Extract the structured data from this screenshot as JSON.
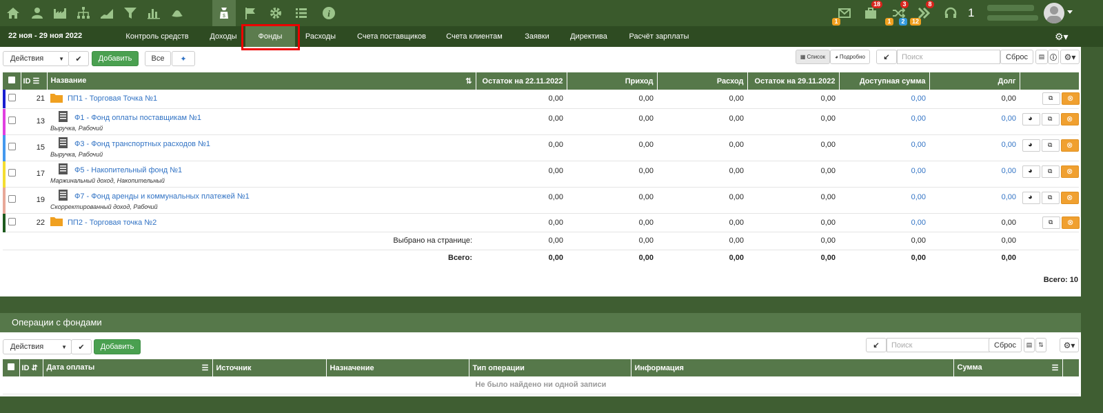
{
  "nav": {
    "icons": [
      "home-icon",
      "user-icon",
      "factory-icon",
      "org-chart-icon",
      "chart-area-icon",
      "filter-icon",
      "bar-chart-icon",
      "hat-icon",
      "money-bag-icon",
      "flag-icon",
      "gear-icon",
      "list-icon",
      "info-icon"
    ],
    "active": "money-bag-icon"
  },
  "header": {
    "messages_badge": "1",
    "tasks_badge": "18",
    "tasks_sub": "1",
    "shuffle_badge": "3",
    "shuffle_sub_a": "2",
    "shuffle_sub_b": "12",
    "forward_badge": "8",
    "counter": "1"
  },
  "subnav": {
    "date_range": "22 ноя - 29 ноя 2022",
    "tabs": [
      "Контроль средств",
      "Доходы",
      "Фонды",
      "Расходы",
      "Счета поставщиков",
      "Счета клиентам",
      "Заявки",
      "Директива",
      "Расчёт зарплаты"
    ],
    "active_tab": "Фонды"
  },
  "toolbar": {
    "actions": "Действия",
    "add": "Добавить",
    "all": "Все",
    "view_list": "Список",
    "view_detail": "Подробно",
    "search_placeholder": "Поиск",
    "reset": "Сброс"
  },
  "funds_table": {
    "headers": {
      "id": "ID",
      "name": "Название",
      "opening": "Остаток на 22.11.2022",
      "income": "Приход",
      "expense": "Расход",
      "closing": "Остаток на 29.11.2022",
      "available": "Доступная сумма",
      "debt": "Долг"
    },
    "rows": [
      {
        "id": "21",
        "name": "ПП1 - Торговая Точка №1",
        "tags": "",
        "kind": "folder",
        "color": "#1a1fd0",
        "opening": "0,00",
        "income": "0,00",
        "expense": "0,00",
        "closing": "0,00",
        "available": "0,00",
        "debt": "0,00"
      },
      {
        "id": "13",
        "name": "Ф1 - Фонд оплаты поставщикам №1",
        "tags": "Выручка, Рабочий",
        "kind": "doc",
        "color": "#e040e0",
        "opening": "0,00",
        "income": "0,00",
        "expense": "0,00",
        "closing": "0,00",
        "available": "0,00",
        "debt": "0,00"
      },
      {
        "id": "15",
        "name": "Ф3 - Фонд транспортных расходов №1",
        "tags": "Выручка, Рабочий",
        "kind": "doc",
        "color": "#4499ee",
        "opening": "0,00",
        "income": "0,00",
        "expense": "0,00",
        "closing": "0,00",
        "available": "0,00",
        "debt": "0,00"
      },
      {
        "id": "17",
        "name": "Ф5 - Накопительный фонд №1",
        "tags": "Маржинальный доход, Накопительный",
        "kind": "doc",
        "color": "#f4dd30",
        "opening": "0,00",
        "income": "0,00",
        "expense": "0,00",
        "closing": "0,00",
        "available": "0,00",
        "debt": "0,00"
      },
      {
        "id": "19",
        "name": "Ф7 - Фонд аренды и коммунальных платежей №1",
        "tags": "Скорректированный доход, Рабочий",
        "kind": "doc",
        "color": "#e8a898",
        "opening": "0,00",
        "income": "0,00",
        "expense": "0,00",
        "closing": "0,00",
        "available": "0,00",
        "debt": "0,00"
      },
      {
        "id": "22",
        "name": "ПП2 - Торговая точка №2",
        "tags": "",
        "kind": "folder",
        "color": "#1e5a1e",
        "opening": "0,00",
        "income": "0,00",
        "expense": "0,00",
        "closing": "0,00",
        "available": "0,00",
        "debt": "0,00"
      }
    ],
    "selected_label": "Выбрано на странице:",
    "selected": [
      "0,00",
      "0,00",
      "0,00",
      "0,00",
      "0,00",
      "0,00"
    ],
    "total_label": "Всего:",
    "total": [
      "0,00",
      "0,00",
      "0,00",
      "0,00",
      "0,00",
      "0,00"
    ],
    "count": "Всего: 10"
  },
  "operations": {
    "title": "Операции с фондами",
    "headers": {
      "id": "ID",
      "date": "Дата оплаты",
      "source": "Источник",
      "target": "Назначение",
      "type": "Тип операции",
      "info": "Информация",
      "sum": "Сумма"
    },
    "empty": "Не было найдено ни одной записи"
  }
}
